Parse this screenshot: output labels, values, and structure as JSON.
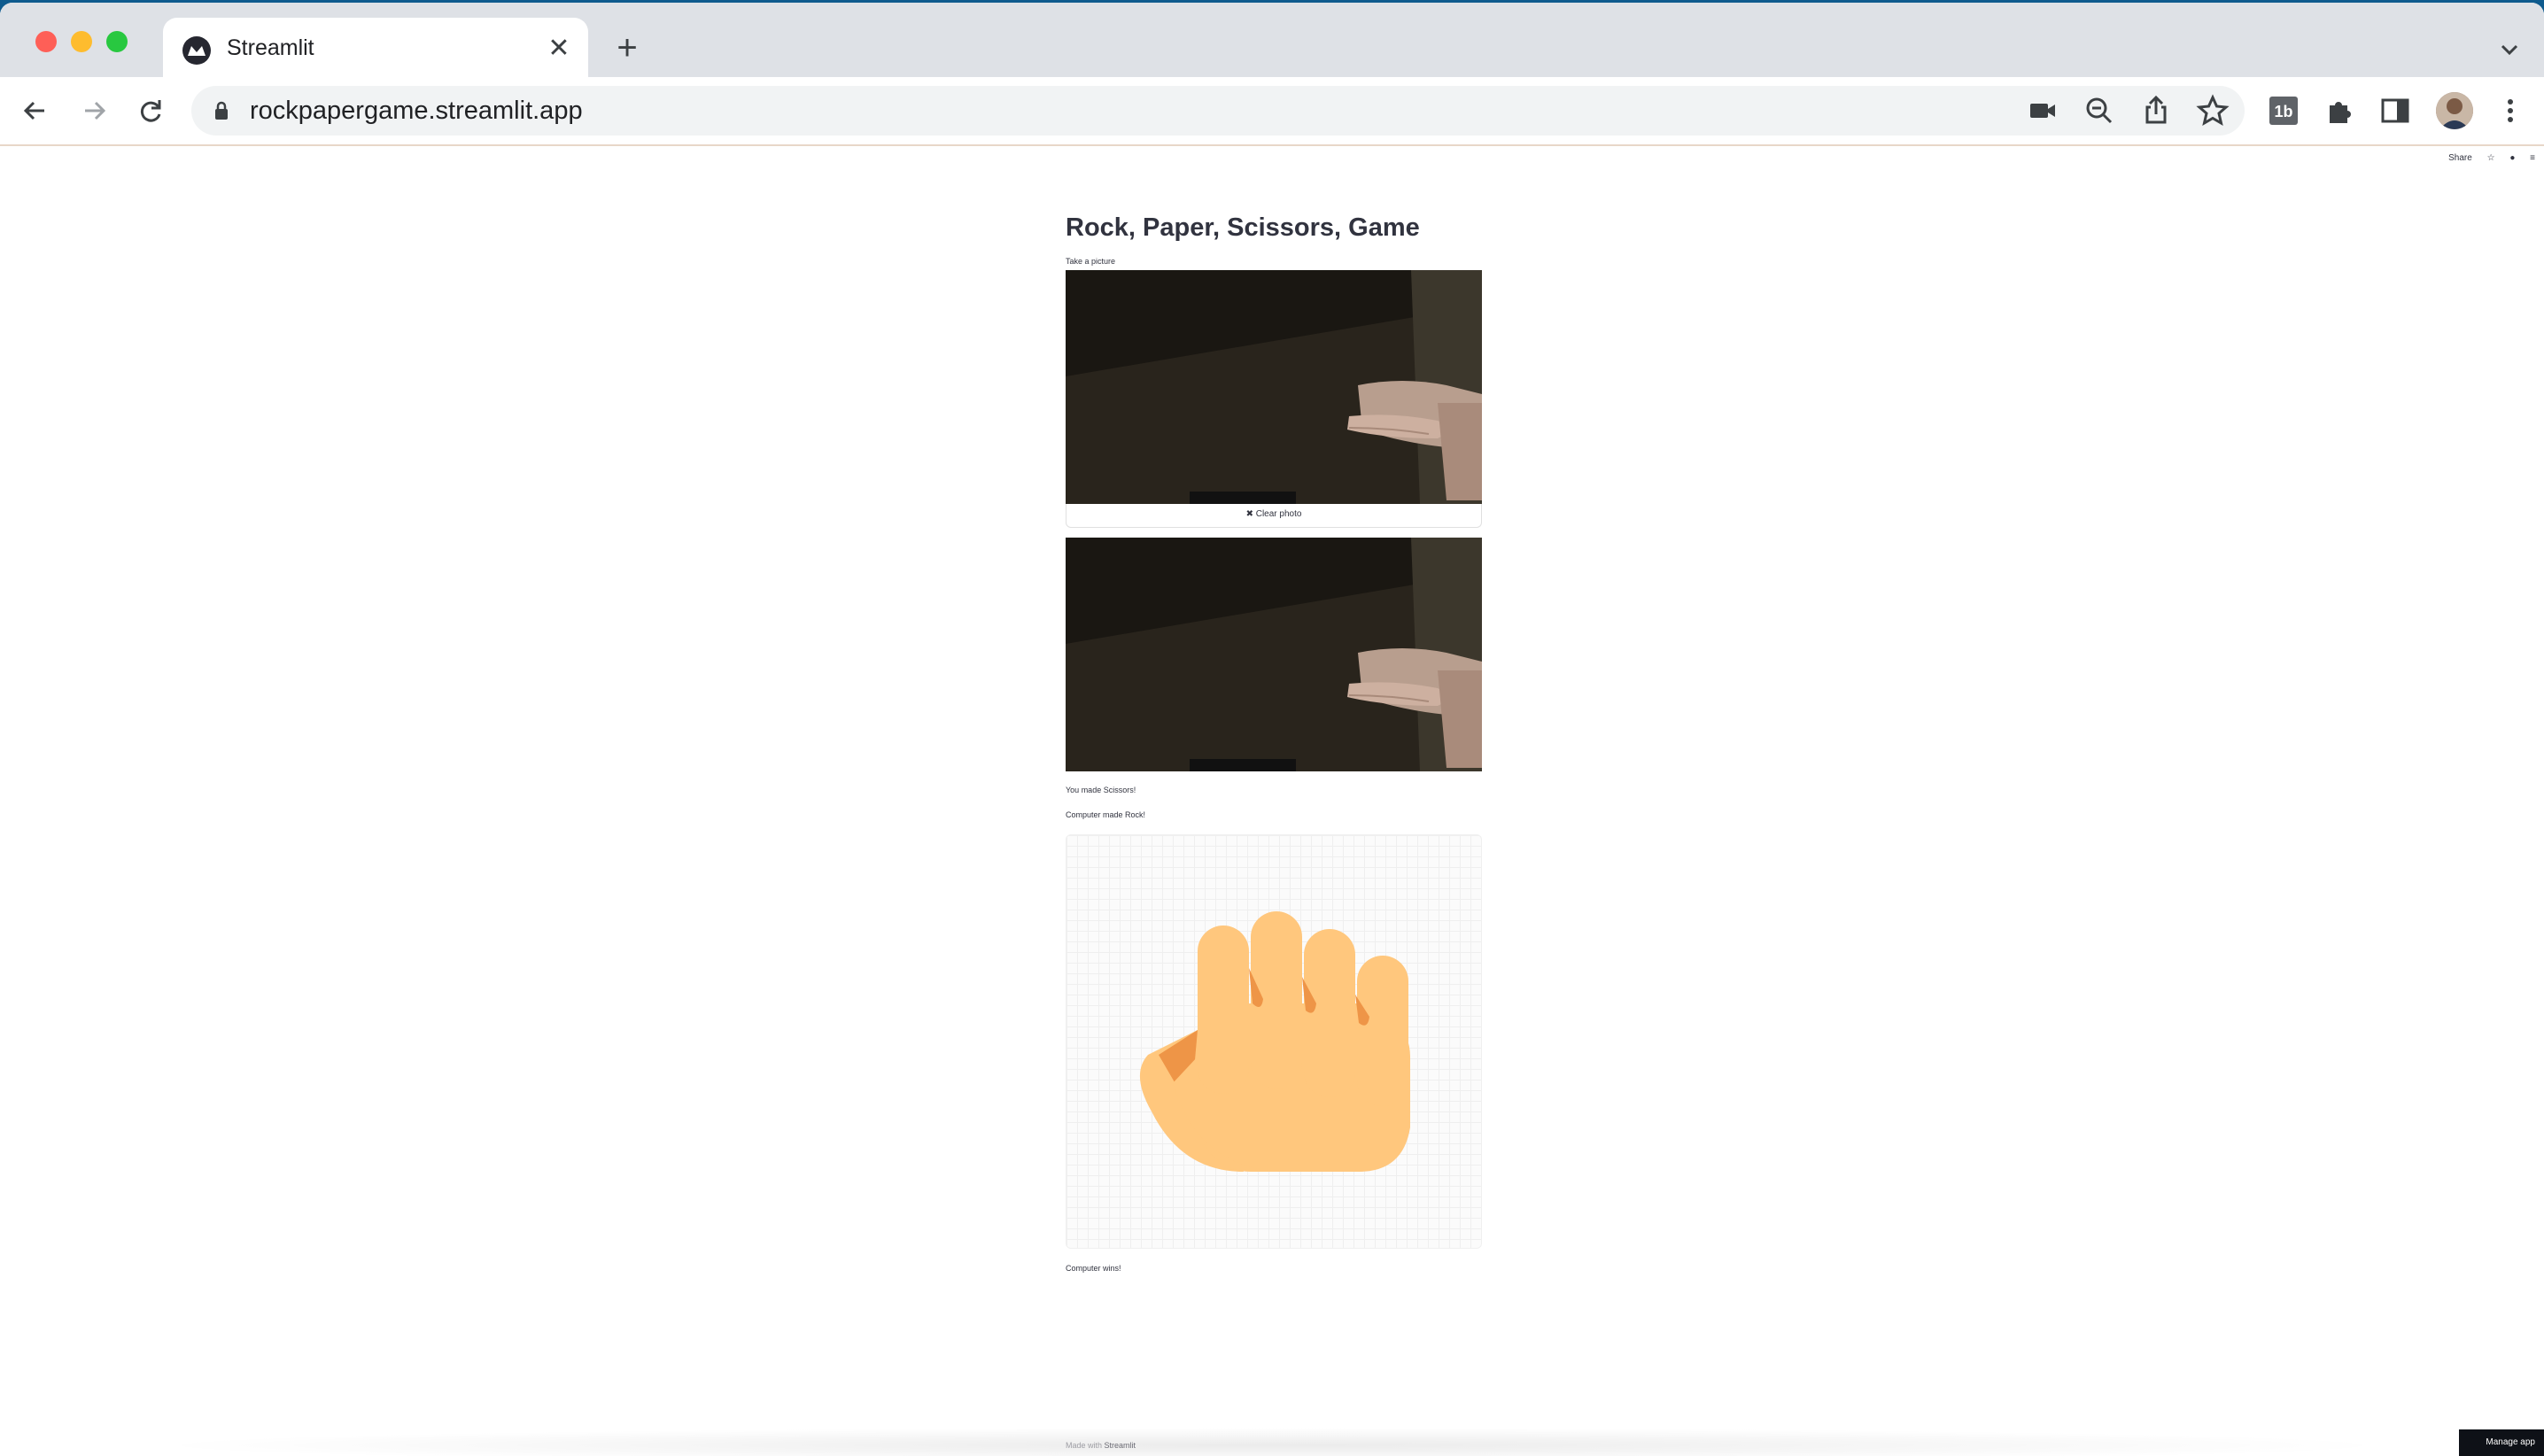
{
  "browser": {
    "tab_title": "Streamlit",
    "url": "rockpapergame.streamlit.app"
  },
  "header_actions": {
    "share_label": "Share"
  },
  "app": {
    "title": "Rock, Paper, Scissors, Game",
    "camera_label": "Take a picture",
    "clear_photo_label": "✖ Clear photo",
    "you_made": "You made Scissors!",
    "computer_made": "Computer made Rock!",
    "result": "Computer wins!"
  },
  "footer": {
    "made_with": "Made with",
    "brand": "Streamlit",
    "manage_app": "Manage app"
  },
  "colors": {
    "tab_strip": "#dee1e6",
    "text": "#31333f",
    "hand_skin": "#ffc77d",
    "hand_shadow": "#ee9547"
  }
}
